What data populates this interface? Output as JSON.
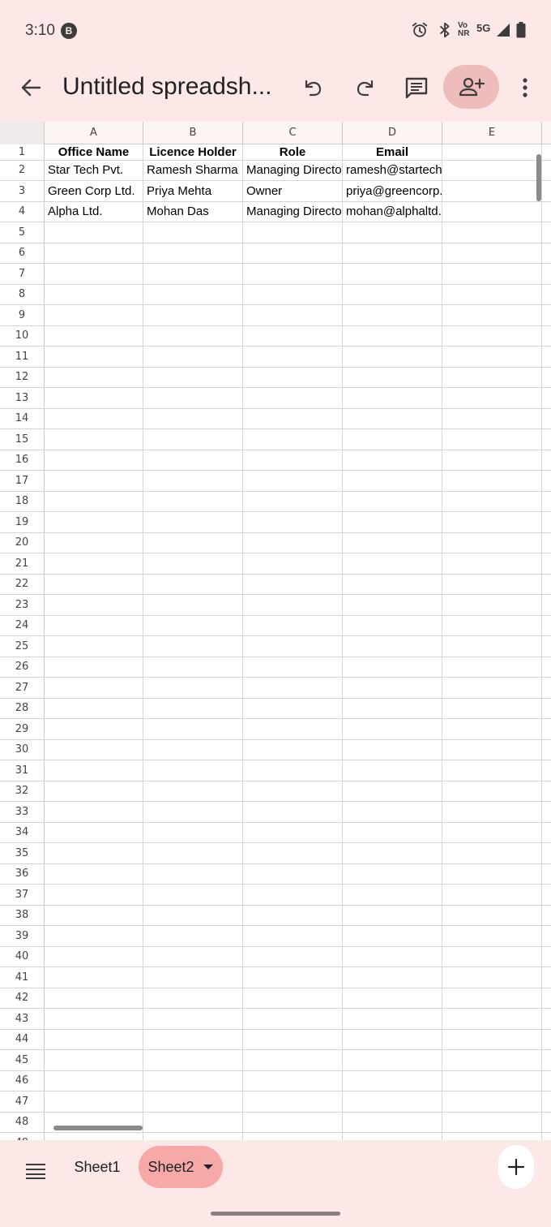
{
  "status_bar": {
    "time": "3:10",
    "badge": "B",
    "icons": [
      "alarm-icon",
      "bluetooth-icon",
      "volte-nr-icon",
      "5g-icon",
      "signal-icon",
      "battery-icon"
    ],
    "network_top": "Vo",
    "network_bottom": "NR",
    "network_5g": "5G"
  },
  "app_bar": {
    "title": "Untitled spreadsh..."
  },
  "sheet": {
    "columns": [
      "A",
      "B",
      "C",
      "D",
      "E"
    ],
    "rows": [
      [
        "Office Name",
        "Licence Holder",
        "Role",
        "Email",
        ""
      ],
      [
        "Star Tech Pvt.",
        "Ramesh Sharma",
        "Managing Director",
        "ramesh@startech.com",
        ""
      ],
      [
        "Green Corp Ltd.",
        "Priya Mehta",
        "Owner",
        "priya@greencorp.com",
        ""
      ],
      [
        "Alpha Ltd.",
        "Mohan Das",
        "Managing Director",
        "mohan@alphaltd.com",
        ""
      ]
    ],
    "visible_rows": 48
  },
  "bottom_bar": {
    "tabs": [
      {
        "label": "Sheet1",
        "active": false
      },
      {
        "label": "Sheet2",
        "active": true
      }
    ]
  },
  "colors": {
    "background": "#fce8e6",
    "active_tab": "#f7a9a8",
    "share_button": "#efbcbc"
  }
}
